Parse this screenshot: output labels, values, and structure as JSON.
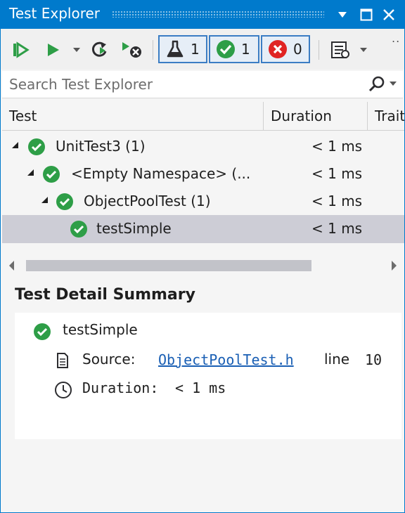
{
  "window": {
    "title": "Test Explorer",
    "accent_color": "#007acc"
  },
  "toolbar": {
    "run_all_icon": "run-all-icon",
    "run_icon": "run-icon",
    "refresh_icon": "refresh-icon",
    "cancel_icon": "cancel-icon",
    "filters": [
      {
        "icon": "flask-icon",
        "count": "1"
      },
      {
        "icon": "passed-icon",
        "count": "1",
        "color": "#2e9e47"
      },
      {
        "icon": "failed-icon",
        "count": "0",
        "color": "#e02424"
      }
    ],
    "playlist_icon": "playlist-icon"
  },
  "search": {
    "placeholder": "Search Test Explorer"
  },
  "columns": {
    "test": "Test",
    "duration": "Duration",
    "traits": "Trait"
  },
  "tree": [
    {
      "label": "UnitTest3 (1)",
      "duration": "< 1 ms",
      "status": "passed"
    },
    {
      "label": "<Empty Namespace> (...",
      "duration": "< 1 ms",
      "status": "passed"
    },
    {
      "label": "ObjectPoolTest (1)",
      "duration": "< 1 ms",
      "status": "passed"
    },
    {
      "label": "testSimple",
      "duration": "< 1 ms",
      "status": "passed",
      "selected": true
    }
  ],
  "detail": {
    "heading": "Test Detail Summary",
    "test_name": "testSimple",
    "source_label": "Source:",
    "source_file": "ObjectPoolTest.h",
    "line_label": "line",
    "line_number": "10",
    "duration_label": "Duration:",
    "duration_value": "< 1 ms"
  },
  "colors": {
    "passed": "#2e9e47",
    "failed": "#e02424",
    "selection": "#cdcdd6"
  }
}
